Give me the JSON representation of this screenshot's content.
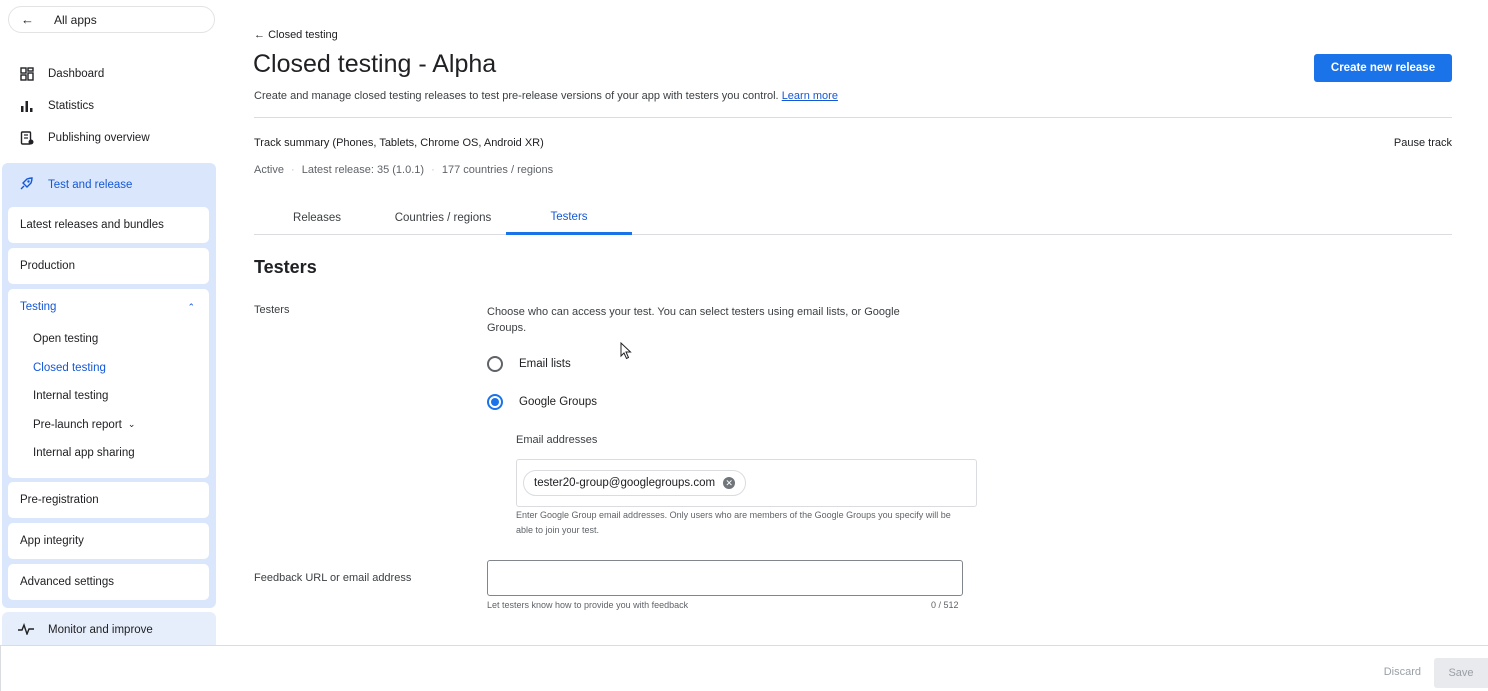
{
  "sidebar": {
    "all_apps": "All apps",
    "top_items": [
      {
        "label": "Dashboard",
        "icon": "dashboard-icon"
      },
      {
        "label": "Statistics",
        "icon": "statistics-icon"
      },
      {
        "label": "Publishing overview",
        "icon": "publishing-icon"
      }
    ],
    "section_title": "Test and release",
    "cards": {
      "latest": "Latest releases and bundles",
      "production": "Production",
      "testing": "Testing",
      "preregistration": "Pre-registration",
      "app_integrity": "App integrity",
      "advanced": "Advanced settings"
    },
    "testing_sub": {
      "open": "Open testing",
      "closed": "Closed testing",
      "internal": "Internal testing",
      "prelaunch": "Pre-launch report",
      "internal_sharing": "Internal app sharing"
    },
    "monitor": "Monitor and improve"
  },
  "header": {
    "back": "Closed testing",
    "title": "Closed testing - Alpha",
    "subtitle": "Create and manage closed testing releases to test pre-release versions of your app with testers you control.",
    "learn_more": "Learn more",
    "create_button": "Create new release"
  },
  "track": {
    "summary": "Track summary (Phones, Tablets, Chrome OS, Android XR)",
    "pause": "Pause track",
    "status": "Active",
    "latest_release": "Latest release: 35 (1.0.1)",
    "countries": "177 countries / regions"
  },
  "tabs": [
    "Releases",
    "Countries / regions",
    "Testers"
  ],
  "active_tab": "Testers",
  "testers": {
    "heading": "Testers",
    "row_label": "Testers",
    "description": "Choose who can access your test. You can select testers using email lists, or Google Groups.",
    "option_email_lists": "Email lists",
    "option_google_groups": "Google Groups",
    "selected_option": "Google Groups",
    "email_addresses_label": "Email addresses",
    "chip_value": "tester20-group@googlegroups.com",
    "helper": "Enter Google Group email addresses. Only users who are members of the Google Groups you specify will be able to join your test."
  },
  "feedback": {
    "label": "Feedback URL or email address",
    "value": "",
    "helper": "Let testers know how to provide you with feedback",
    "count": "0 / 512"
  },
  "footer": {
    "discard": "Discard",
    "save": "Save"
  },
  "colors": {
    "accent": "#1a73e8",
    "section_bg": "#d9e6fb"
  }
}
